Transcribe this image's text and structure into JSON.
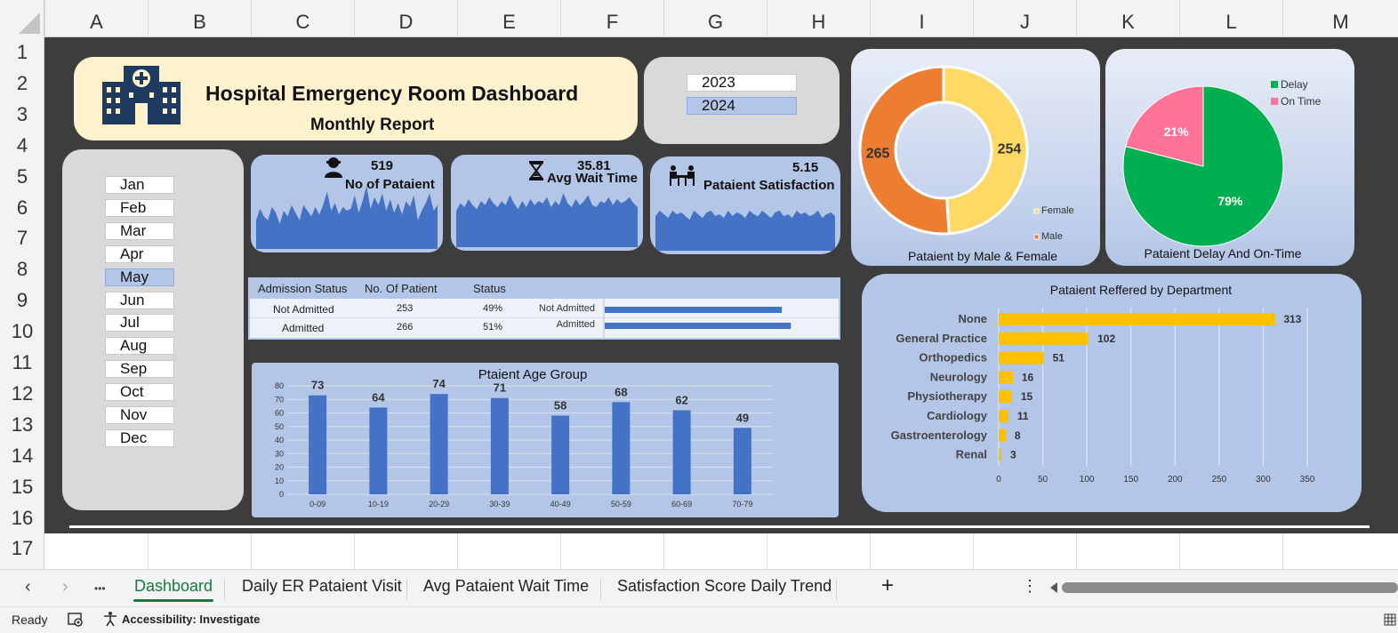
{
  "spreadsheet": {
    "columns": [
      "A",
      "B",
      "C",
      "D",
      "E",
      "F",
      "G",
      "H",
      "I",
      "J",
      "K",
      "L",
      "M"
    ],
    "rows": [
      "1",
      "2",
      "3",
      "4",
      "5",
      "6",
      "7",
      "8",
      "9",
      "10",
      "11",
      "12",
      "13",
      "14",
      "15",
      "16",
      "17"
    ]
  },
  "dashboard": {
    "title": "Hospital Emergency Room Dashboard",
    "subtitle": "Monthly Report",
    "years": [
      {
        "label": "2023",
        "selected": false
      },
      {
        "label": "2024",
        "selected": true
      }
    ],
    "months": [
      {
        "label": "Jan",
        "selected": false
      },
      {
        "label": "Feb",
        "selected": false
      },
      {
        "label": "Mar",
        "selected": false
      },
      {
        "label": "Apr",
        "selected": false
      },
      {
        "label": "May",
        "selected": true
      },
      {
        "label": "Jun",
        "selected": false
      },
      {
        "label": "Jul",
        "selected": false
      },
      {
        "label": "Aug",
        "selected": false
      },
      {
        "label": "Sep",
        "selected": false
      },
      {
        "label": "Oct",
        "selected": false
      },
      {
        "label": "Nov",
        "selected": false
      },
      {
        "label": "Dec",
        "selected": false
      }
    ],
    "kpis": {
      "patients": {
        "value": "519",
        "label": "No of Pataient",
        "icon": "person-icon"
      },
      "wait": {
        "value": "35.81",
        "label": "Avg Wait Time",
        "icon": "hourglass-icon"
      },
      "satisfaction": {
        "value": "5.15",
        "label": "Pataient Satisfaction",
        "icon": "meeting-icon"
      }
    },
    "admission": {
      "headers": [
        "Admission Status",
        "No. Of Patient",
        "Status"
      ],
      "rows": [
        {
          "status": "Not Admitted",
          "count": "253",
          "pct": "49%",
          "bar_label": "Not Admitted",
          "value": 253
        },
        {
          "status": "Admitted",
          "count": "266",
          "pct": "51%",
          "bar_label": "Admitted",
          "value": 266
        }
      ]
    }
  },
  "chart_data": [
    {
      "type": "area",
      "title": "No of Pataient",
      "values": [
        30,
        42,
        34,
        30,
        44,
        38,
        26,
        40,
        34,
        46,
        38,
        30,
        46,
        40,
        34,
        44,
        36,
        46,
        60,
        40,
        48,
        36,
        44,
        40,
        42,
        56,
        38,
        50,
        66,
        42,
        54,
        46,
        58,
        40,
        52,
        38,
        48,
        36,
        50,
        44,
        56,
        30,
        40,
        48,
        58,
        40,
        46
      ],
      "ylim": [
        0,
        80
      ]
    },
    {
      "type": "area",
      "title": "Avg Wait Time",
      "values": [
        36,
        44,
        40,
        48,
        42,
        38,
        46,
        42,
        50,
        44,
        40,
        46,
        42,
        52,
        44,
        38,
        46,
        40,
        48,
        42,
        46,
        44,
        50,
        40,
        46,
        42,
        54,
        44,
        40,
        48,
        42,
        46,
        52,
        42,
        40,
        46,
        44,
        50,
        42,
        48,
        44,
        46,
        50,
        44,
        40
      ],
      "ylim": [
        0,
        80
      ]
    },
    {
      "type": "area",
      "title": "Pataient Satisfaction",
      "values": [
        38,
        44,
        40,
        36,
        44,
        40,
        42,
        38,
        34,
        44,
        40,
        36,
        42,
        44,
        38,
        40,
        36,
        44,
        38,
        42,
        40,
        36,
        44,
        40,
        38,
        44,
        40,
        36,
        42,
        44,
        38,
        40,
        36,
        44,
        40,
        42,
        38,
        40,
        44,
        36,
        40,
        42,
        38
      ],
      "ylim": [
        0,
        80
      ]
    },
    {
      "type": "pie",
      "title": "Pataient  by Male & Female",
      "donut": true,
      "slices": [
        {
          "label": "Female",
          "value": 254,
          "color": "#ffd966"
        },
        {
          "label": "Male",
          "value": 265,
          "color": "#ed7d31"
        }
      ],
      "legend_labels": [
        "Female",
        "Male"
      ]
    },
    {
      "type": "pie",
      "title": "Pataient Delay And On-Time",
      "slices": [
        {
          "label": "Delay",
          "value": 79,
          "display": "79%",
          "color": "#00b050"
        },
        {
          "label": "On Time",
          "value": 21,
          "display": "21%",
          "color": "#ff7399"
        }
      ],
      "legend_labels": [
        "Delay",
        "On Time"
      ]
    },
    {
      "type": "bar",
      "title": "Ptaient Age Group",
      "categories": [
        "0-09",
        "10-19",
        "20-29",
        "30-39",
        "40-49",
        "50-59",
        "60-69",
        "70-79"
      ],
      "values": [
        73,
        64,
        74,
        71,
        58,
        68,
        62,
        49
      ],
      "ylim": [
        0,
        80
      ],
      "yticks": [
        "0",
        "10",
        "20",
        "30",
        "40",
        "50",
        "60",
        "70",
        "80"
      ],
      "color": "#4472c4"
    },
    {
      "type": "bar",
      "orientation": "horizontal",
      "title": "Pataient Reffered by Department",
      "categories": [
        "None",
        "General Practice",
        "Orthopedics",
        "Neurology",
        "Physiotherapy",
        "Cardiology",
        "Gastroenterology",
        "Renal"
      ],
      "values": [
        313,
        102,
        51,
        16,
        15,
        11,
        8,
        3
      ],
      "xlim": [
        0,
        350
      ],
      "xticks": [
        "0",
        "50",
        "100",
        "150",
        "200",
        "250",
        "300",
        "350"
      ],
      "color": "#ffc000"
    },
    {
      "type": "bar",
      "orientation": "horizontal",
      "title": "Admission Status",
      "categories": [
        "Not Admitted",
        "Admitted"
      ],
      "values": [
        253,
        266
      ],
      "color": "#4472c4"
    }
  ],
  "tabs": {
    "items": [
      "Dashboard",
      "Daily ER Pataient Visit",
      "Avg Pataient Wait Time",
      "Satisfaction Score Daily Trend"
    ],
    "active": "Dashboard",
    "add": "+",
    "more": "•••",
    "menu": "⋮"
  },
  "status": {
    "ready": "Ready",
    "accessibility": "Accessibility: Investigate"
  }
}
